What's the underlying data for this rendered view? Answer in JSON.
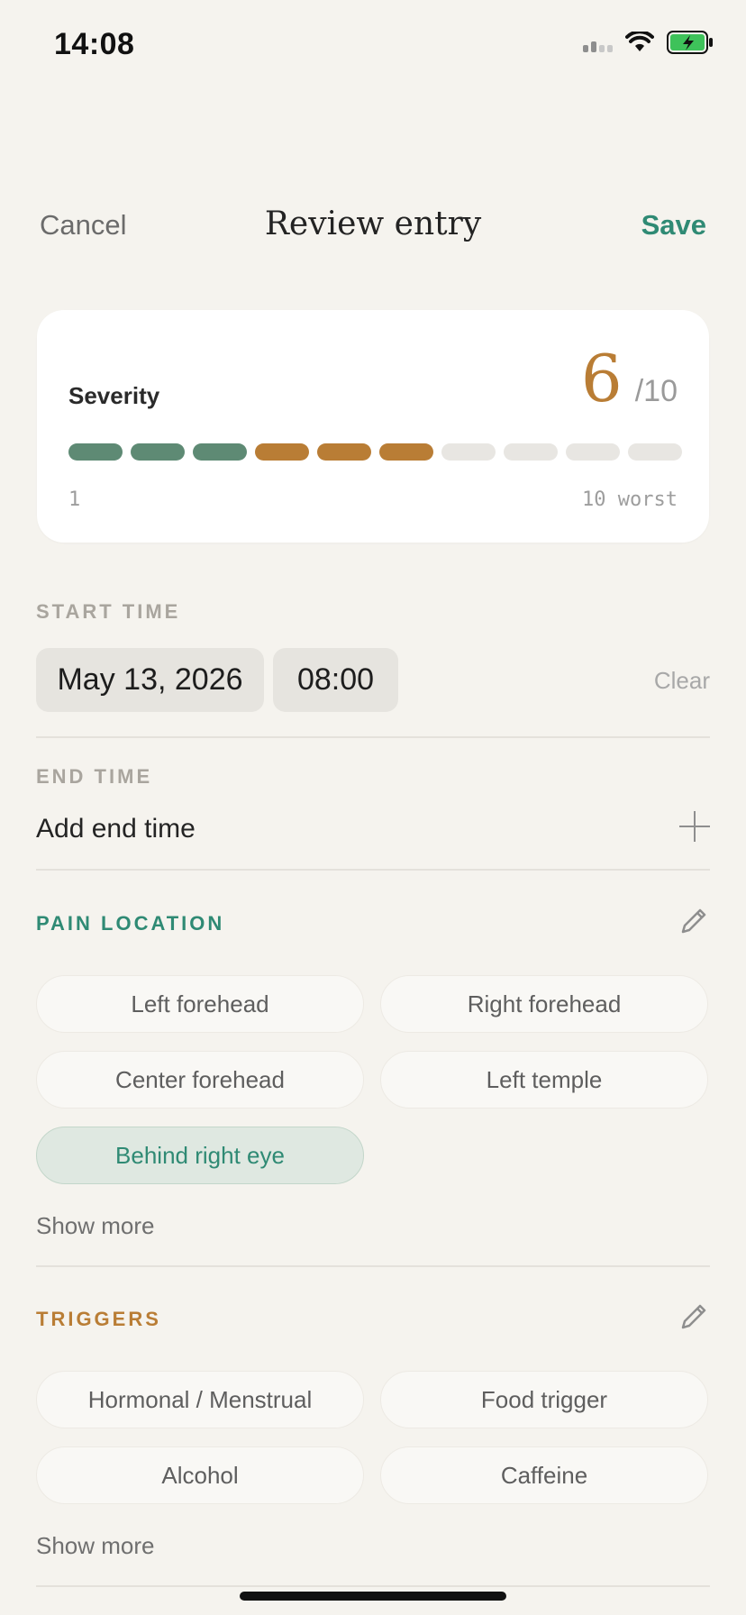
{
  "status_bar": {
    "time": "14:08",
    "icons": [
      "cellular-signal-icon",
      "wifi-icon",
      "battery-charging-icon"
    ],
    "battery_color": "#3ec25a"
  },
  "nav": {
    "cancel_label": "Cancel",
    "title": "Review entry",
    "save_label": "Save"
  },
  "severity": {
    "label": "Severity",
    "value": "6",
    "max_label": "/10",
    "level": 6,
    "scale_max": 10,
    "min_label": "1",
    "max_caption": "10 worst",
    "colors": {
      "low": "#5e8a74",
      "high": "#b97d35",
      "empty": "#e8e6e2"
    }
  },
  "start_time": {
    "heading": "START TIME",
    "date": "May 13, 2026",
    "time": "08:00",
    "clear_label": "Clear"
  },
  "end_time": {
    "heading": "END TIME",
    "add_label": "Add end time",
    "add_icon": "plus-icon"
  },
  "pain_location": {
    "heading": "PAIN LOCATION",
    "heading_color": "#2f8a74",
    "edit_icon": "pencil-icon",
    "chips": [
      {
        "label": "Left forehead",
        "selected": false
      },
      {
        "label": "Right forehead",
        "selected": false
      },
      {
        "label": "Center forehead",
        "selected": false
      },
      {
        "label": "Left temple",
        "selected": false
      },
      {
        "label": "Behind right eye",
        "selected": true
      }
    ],
    "show_more": "Show more"
  },
  "triggers": {
    "heading": "TRIGGERS",
    "heading_color": "#b97d35",
    "edit_icon": "pencil-icon",
    "chips": [
      {
        "label": "Hormonal / Menstrual",
        "selected": false
      },
      {
        "label": "Food trigger",
        "selected": false
      },
      {
        "label": "Alcohol",
        "selected": false
      },
      {
        "label": "Caffeine",
        "selected": false
      }
    ],
    "show_more": "Show more"
  }
}
